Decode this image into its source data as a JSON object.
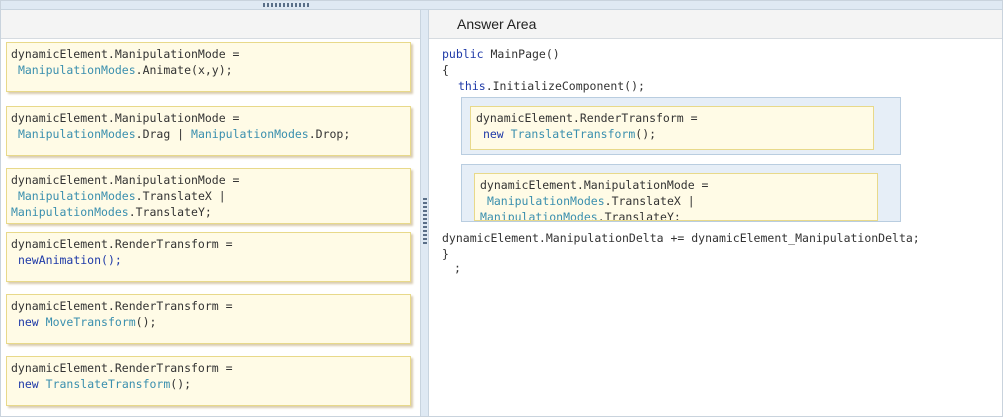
{
  "answer_area": {
    "title": "Answer Area"
  },
  "tiles": [
    {
      "line1": "dynamicElement.ManipulationMode =",
      "type1": "ManipulationModes",
      "rest2": ".Animate(x,y);"
    },
    {
      "line1": "dynamicElement.ManipulationMode =",
      "type1": "ManipulationModes",
      "mid2": ".Drag | ",
      "type2": "ManipulationModes",
      "rest2": ".Drop;"
    },
    {
      "line1": "dynamicElement.ManipulationMode =",
      "type1": "ManipulationModes",
      "rest2": ".TranslateX |",
      "type3": "ManipulationModes",
      "rest3": ".TranslateY;"
    },
    {
      "line1": "dynamicElement.RenderTransform =",
      "kw": "new",
      "rest2": "Animation();"
    },
    {
      "line1": "dynamicElement.RenderTransform =",
      "kw": "new",
      "type1": "MoveTransform",
      "rest2": "();"
    },
    {
      "line1": "dynamicElement.RenderTransform =",
      "kw": "new",
      "type1": "TranslateTransform",
      "rest2": "();"
    }
  ],
  "code": {
    "sig_kw": "public",
    "sig_rest": " MainPage()",
    "open_brace": "{",
    "this_kw": "this",
    "init": ".InitializeComponent();",
    "delta": "dynamicElement.ManipulationDelta += dynamicElement_ManipulationDelta;",
    "close_brace": "}",
    "semicolon": ";"
  },
  "slots": [
    {
      "line1": "dynamicElement.RenderTransform =",
      "kw": "new",
      "type1": "TranslateTransform",
      "rest2": "();"
    },
    {
      "line1": "dynamicElement.ManipulationMode =",
      "type1": "ManipulationModes",
      "rest2": ".TranslateX |",
      "type2": "ManipulationModes",
      "rest3": ".TranslateY;"
    }
  ]
}
